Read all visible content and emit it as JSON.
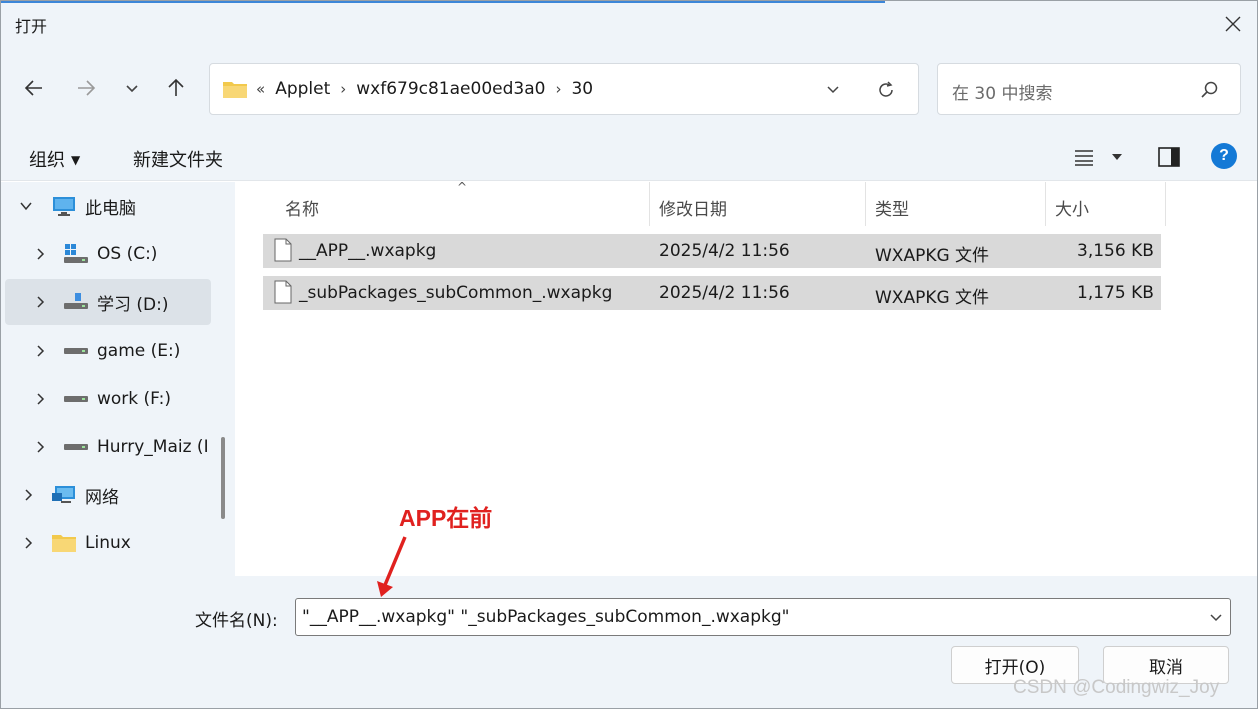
{
  "window": {
    "title": "打开"
  },
  "address": {
    "segments": [
      "«",
      "Applet",
      "›",
      "wxf679c81ae00ed3a0",
      "›",
      "30"
    ]
  },
  "search": {
    "placeholder": "在 30 中搜索"
  },
  "toolbar": {
    "organize_label": "组织",
    "new_folder_label": "新建文件夹"
  },
  "sidebar": {
    "items": [
      {
        "label": "此电脑",
        "icon": "computer-icon"
      },
      {
        "label": "OS (C:)",
        "icon": "windows-drive-icon"
      },
      {
        "label": "学习 (D:)",
        "icon": "usb-drive-icon"
      },
      {
        "label": "game (E:)",
        "icon": "drive-icon"
      },
      {
        "label": "work (F:)",
        "icon": "drive-icon"
      },
      {
        "label": "Hurry_Maiz (I",
        "icon": "drive-icon"
      },
      {
        "label": "网络",
        "icon": "network-icon"
      },
      {
        "label": "Linux",
        "icon": "folder-icon"
      }
    ]
  },
  "columns": {
    "name": "名称",
    "modified": "修改日期",
    "type": "类型",
    "size": "大小"
  },
  "files": [
    {
      "name": "__APP__.wxapkg",
      "modified": "2025/4/2 11:56",
      "type": "WXAPKG 文件",
      "size": "3,156 KB"
    },
    {
      "name": "_subPackages_subCommon_.wxapkg",
      "modified": "2025/4/2 11:56",
      "type": "WXAPKG 文件",
      "size": "1,175 KB"
    }
  ],
  "filename": {
    "label": "文件名(N):",
    "value": "\"__APP__.wxapkg\" \"_subPackages_subCommon_.wxapkg\""
  },
  "buttons": {
    "open": "打开(O)",
    "cancel": "取消"
  },
  "annotation": {
    "text": "APP在前",
    "color": "#e0211f"
  },
  "watermark": "CSDN @Codingwiz_Joy",
  "colors": {
    "accent": "#1479d6",
    "chrome": "#eff4f9",
    "selection": "#d9d9d9"
  }
}
